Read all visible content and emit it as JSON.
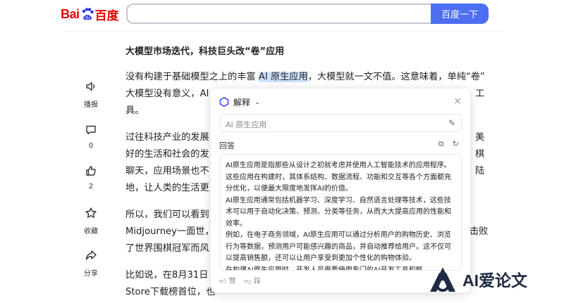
{
  "header": {
    "logo_text_bai": "Bai",
    "logo_text_du": "百度",
    "search_value": "",
    "search_button": "百度一下"
  },
  "rail": {
    "broadcast_label": "播报",
    "comment_count": "0",
    "like_count": "2",
    "collect_label": "收藏",
    "share_label": "分享"
  },
  "article": {
    "title": "大模型市场迭代，科技巨头改“卷”应用",
    "p1_l1_a": "没有构建于基础模型之上的丰富 ",
    "p1_l1_hl": "AI 原生应用",
    "p1_l1_b": "，大模型就一文不值。这意味着，单纯“卷”",
    "p1_l2": "大模型没有意义，AI",
    "p1_l2_tail": "工",
    "p1_l3": "具。",
    "p2_l1": "过往科技产业的发展",
    "p2_l1_tail": "美",
    "p2_l2": "好的生活和社会的发",
    "p2_l2_tail": "棋",
    "p2_l3": "聊天，应用场景也不",
    "p2_l3_tail": "陆",
    "p2_l4": "地，让人类的生活更",
    "p3_l1": "所以，我们可以看到",
    "p3_l2": "Midjourney一面世，",
    "p3_l2_tail": "击败",
    "p3_l3": "了世界围棋冠军而风",
    "p4_l1": "比如说，在8月31日",
    "p4_l2": "Store下载榜首位，也"
  },
  "popup": {
    "title": "解释",
    "query": "AI 原生应用",
    "answer_label": "回答",
    "answer_paragraphs": [
      "AI原生应用是指那些从设计之初就考虑并使用人工智能技术的应用程序。这些应用在构建时，其体系结构、数据流程、功能和交互等各个方面都充分优化，以便最大限度地发挥AI的价值。",
      "AI原生应用通常包括机器学习、深度学习、自然语言处理等技术，这些技术可以用于自动化决策、预测、分类等任务，从而大大提高应用的性能和效率。",
      "例如，在电子商务领域，AI原生应用可以通过分析用户的购物历史、浏览行为等数据，预测用户可能感兴趣的商品，并自动推荐给用户。这不仅可以提高销售额，还可以让用户享受到更加个性化的购物体验。",
      "在构建AI原生应用时，开发人员需要使用专门的AI开发工具和框"
    ],
    "like_label": "赞",
    "dislike_label": "踩"
  },
  "watermark": {
    "text": "AI爱论文"
  },
  "colors": {
    "search_button": "#4e6ef2",
    "logo_red": "#e10602",
    "highlight": "#cfe3ff"
  }
}
